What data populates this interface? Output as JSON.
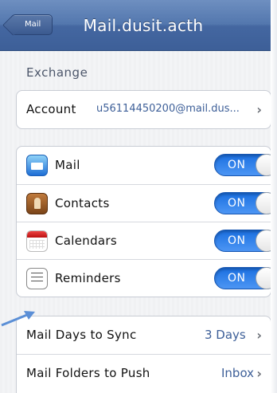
{
  "nav": {
    "back_label": "Mail",
    "title": "Mail.dusit.acth"
  },
  "section": {
    "header": "Exchange"
  },
  "account": {
    "label": "Account",
    "value": "u56114450200@mail.dus..."
  },
  "toggles": [
    {
      "label": "Mail",
      "icon": "mail-icon",
      "state": "ON"
    },
    {
      "label": "Contacts",
      "icon": "contacts-icon",
      "state": "ON"
    },
    {
      "label": "Calendars",
      "icon": "calendar-icon",
      "state": "ON"
    },
    {
      "label": "Reminders",
      "icon": "reminders-icon",
      "state": "ON"
    }
  ],
  "sync": {
    "days_label": "Mail Days to Sync",
    "days_value": "3 Days",
    "folders_label": "Mail Folders to Push",
    "folders_value": "Inbox"
  },
  "colors": {
    "nav_bar": "#5377ae",
    "toggle_on": "#2a7de8",
    "value_text": "#3d5f98",
    "annotation_arrow": "#5b8fd6"
  }
}
